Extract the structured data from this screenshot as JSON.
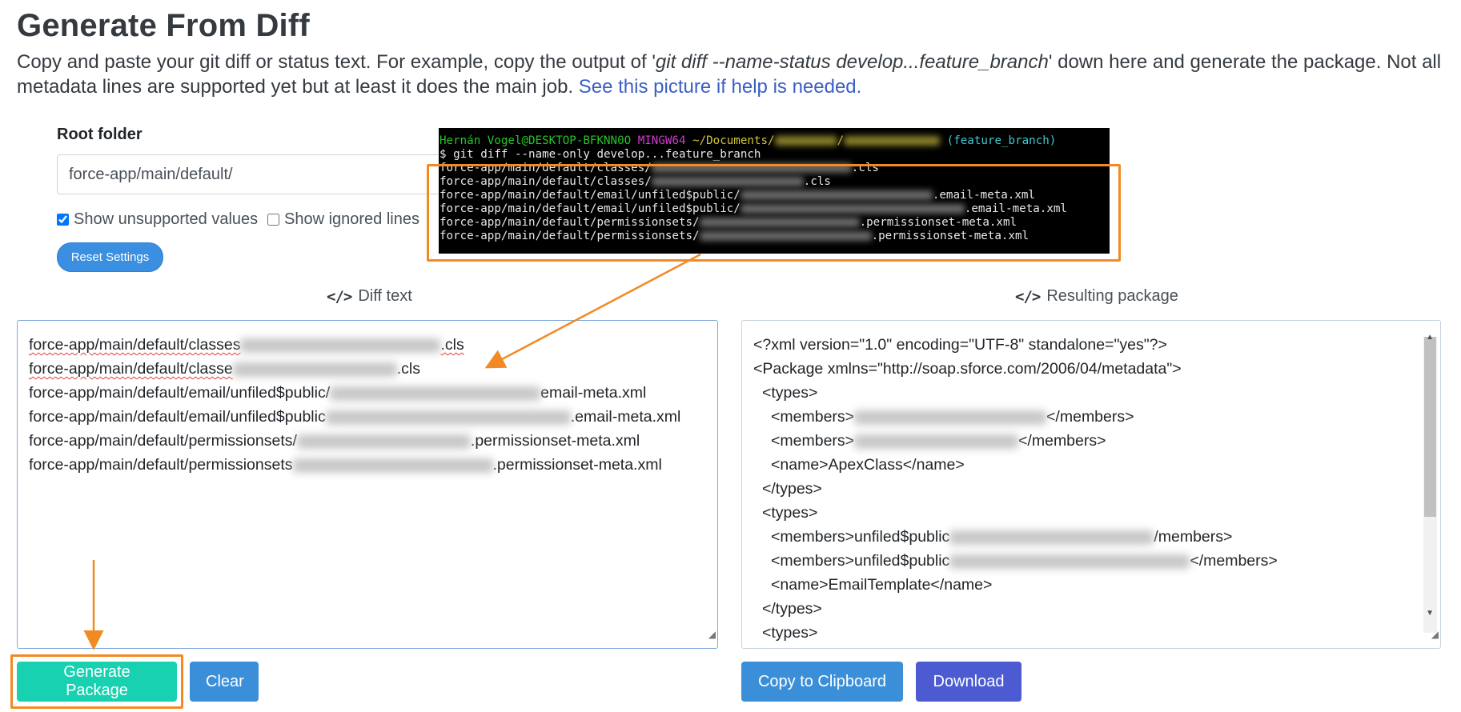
{
  "header": {
    "title": "Generate From Diff",
    "intro_part1": "Copy and paste your git diff or status text. For example, copy the output of '",
    "intro_cmd": "git diff --name-status develop...feature_branch",
    "intro_part2": "' down here and generate the package. Not all metadata lines are supported yet but at least it does the main job. ",
    "help_link": "See this picture if help is needed."
  },
  "settings": {
    "root_folder_label": "Root folder",
    "root_folder_value": "force-app/main/default/",
    "show_unsupported_label": "Show unsupported values",
    "show_unsupported_checked": true,
    "show_ignored_label": "Show ignored lines",
    "show_ignored_checked": false,
    "reset_label": "Reset Settings"
  },
  "terminal": {
    "prompt_user": "Hernán Vogel@DESKTOP-BFKNN0O",
    "prompt_env": "MINGW64",
    "prompt_path": "~/Documents/",
    "prompt_branch": "(feature_branch)",
    "command": "$ git diff --name-only develop...feature_branch",
    "lines": [
      {
        "prefix": "force-app/main/default/classes/",
        "suffix": ".cls"
      },
      {
        "prefix": "force-app/main/default/classes/",
        "suffix": ".cls"
      },
      {
        "prefix": "force-app/main/default/email/unfiled$public/",
        "suffix": ".email-meta.xml"
      },
      {
        "prefix": "force-app/main/default/email/unfiled$public/",
        "suffix": ".email-meta.xml"
      },
      {
        "prefix": "force-app/main/default/permissionsets/",
        "suffix": ".permissionset-meta.xml"
      },
      {
        "prefix": "force-app/main/default/permissionsets/",
        "suffix": ".permissionset-meta.xml"
      }
    ]
  },
  "diff_panel": {
    "heading": "Diff text",
    "lines": [
      {
        "prefix": "force-app/main/default/classes",
        "suffix": ".cls"
      },
      {
        "prefix": "force-app/main/default/classe",
        "suffix": ".cls"
      },
      {
        "prefix": "force-app/main/default/email/unfiled$public/",
        "suffix": "email-meta.xml"
      },
      {
        "prefix": "force-app/main/default/email/unfiled$public",
        "suffix": ".email-meta.xml"
      },
      {
        "prefix": "force-app/main/default/permissionsets/",
        "suffix": ".permissionset-meta.xml"
      },
      {
        "prefix": "force-app/main/default/permissionsets",
        "suffix": ".permissionset-meta.xml"
      }
    ]
  },
  "result_panel": {
    "heading": "Resulting package",
    "xml_decl": "<?xml version=\"1.0\" encoding=\"UTF-8\" standalone=\"yes\"?>",
    "package_open": "<Package xmlns=\"http://soap.sforce.com/2006/04/metadata\">",
    "types_open": "<types>",
    "types_close": "</types>",
    "members_open": "<members>",
    "members_close": "</members>",
    "members_open_email": "<members>unfiled$public",
    "members_close_partial": "/members>",
    "name_apexclass": "<name>ApexClass</name>",
    "name_emailtemplate": "<name>EmailTemplate</name>"
  },
  "actions": {
    "generate_label": "Generate Package",
    "clear_label": "Clear",
    "copy_label": "Copy to Clipboard",
    "download_label": "Download"
  },
  "colors": {
    "annotation": "#f28a24",
    "generate": "#18d1b0",
    "primary": "#3b8fd9",
    "download": "#4c5bd1",
    "link": "#3b5fc4"
  }
}
